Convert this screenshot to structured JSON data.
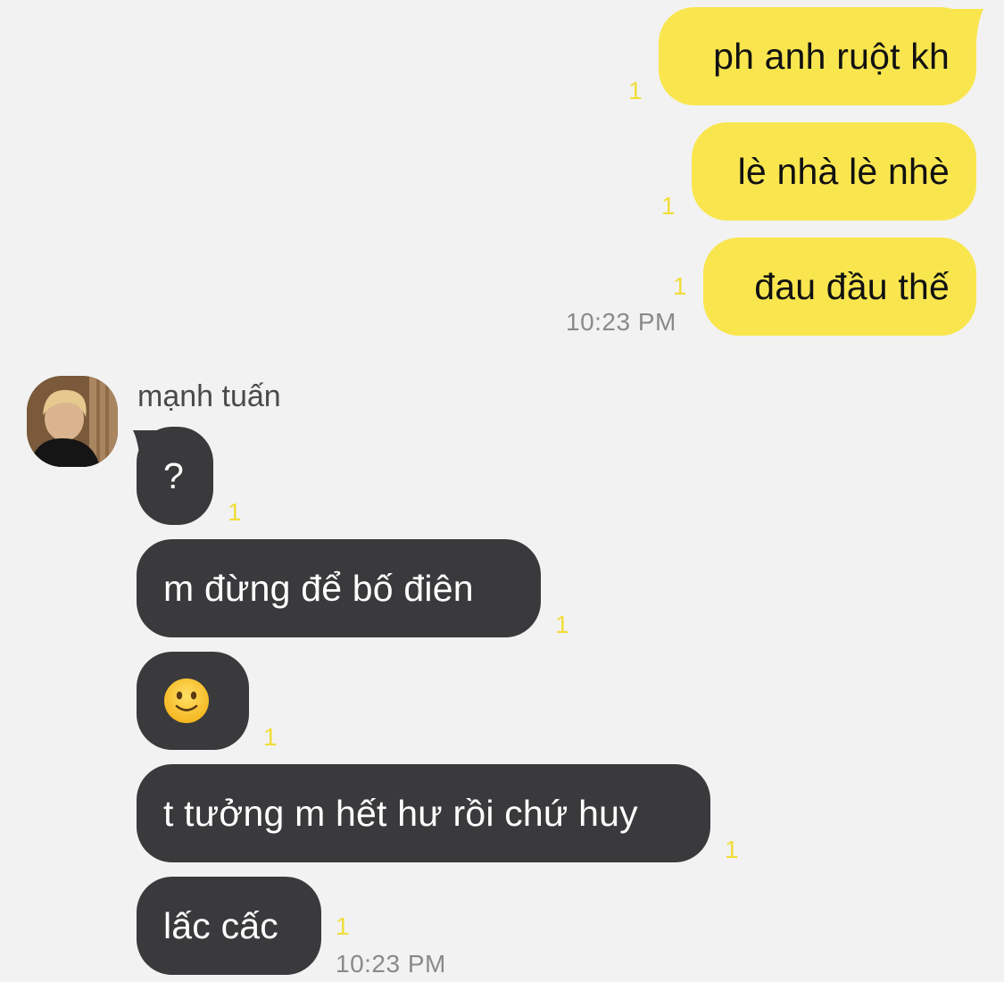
{
  "colors": {
    "background": "#f2f2f2",
    "outgoing_bubble": "#f9e64f",
    "incoming_bubble": "#3a3a3c",
    "read_indicator": "#f0dd38",
    "timestamp": "#8a8a8a"
  },
  "outgoing": {
    "messages": [
      {
        "text": "ph anh ruột kh",
        "read": "1"
      },
      {
        "text": "lè nhà lè nhè",
        "read": "1"
      },
      {
        "text": "đau đầu thế",
        "read": "1"
      }
    ],
    "time": "10:23 PM"
  },
  "incoming": {
    "sender": {
      "name": "mạnh tuấn",
      "avatar_icon": "profile-photo"
    },
    "messages": [
      {
        "text": "?",
        "read": "1"
      },
      {
        "text": "m đừng để bố điên",
        "read": "1"
      },
      {
        "text": "",
        "emoji": "slightly-smiling-face-icon",
        "read": "1"
      },
      {
        "text": "t tưởng m hết hư rồi chứ huy",
        "read": "1"
      },
      {
        "text": "lấc cấc",
        "read": "1"
      }
    ],
    "time": "10:23 PM"
  }
}
